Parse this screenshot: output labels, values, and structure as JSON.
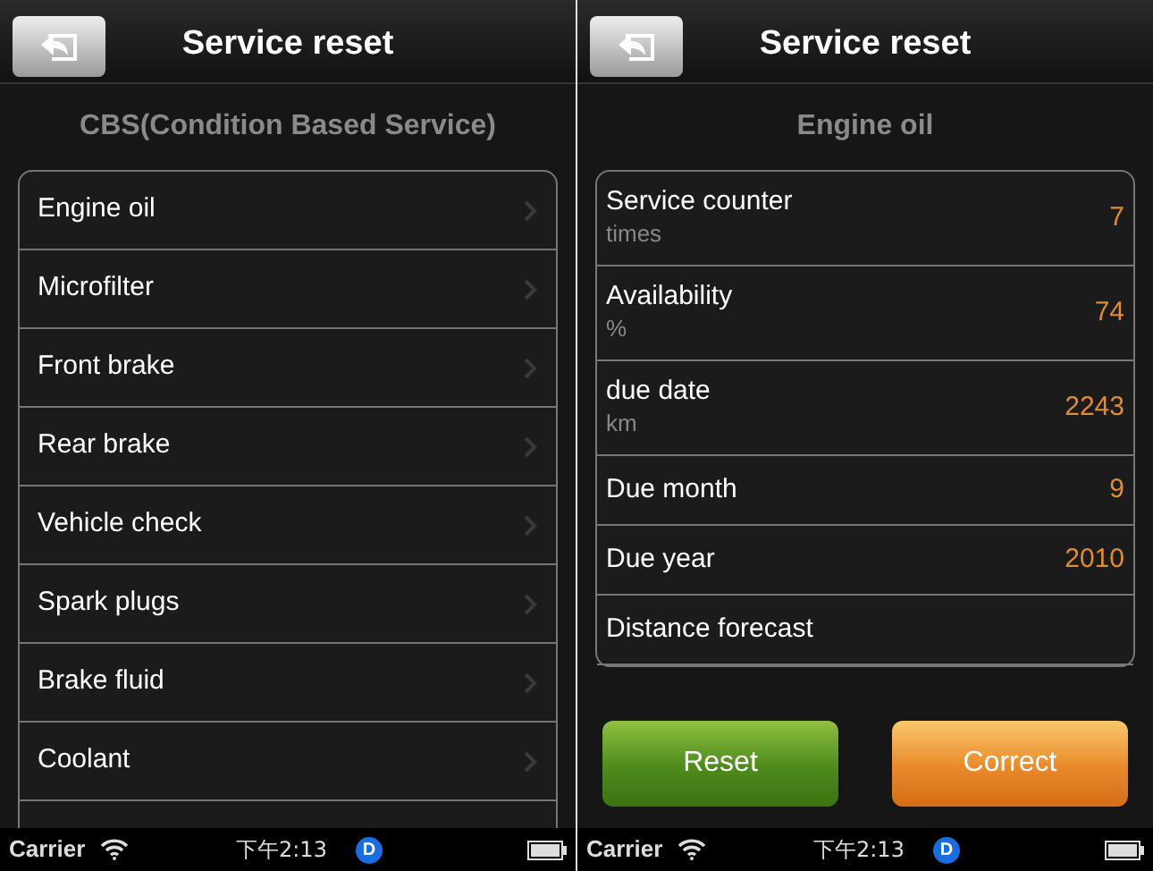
{
  "screens": [
    {
      "kind": "menu",
      "title": "Service reset",
      "subtitle": "CBS(Condition Based Service)",
      "items": [
        "Engine oil",
        "Microfilter",
        "Front brake",
        "Rear brake",
        "Vehicle check",
        "Spark plugs",
        "Brake fluid",
        "Coolant"
      ],
      "status_bar": {
        "carrier": "Carrier",
        "time": "下午2:13",
        "badge": "D"
      }
    },
    {
      "kind": "detail",
      "title": "Service reset",
      "subtitle": "Engine oil",
      "fields": [
        {
          "label": "Service counter",
          "unit": "times",
          "value": "7"
        },
        {
          "label": "Availability",
          "unit": "%",
          "value": "74"
        },
        {
          "label": "due date",
          "unit": "km",
          "value": "2243"
        },
        {
          "label": "Due month",
          "value": "9"
        },
        {
          "label": "Due year",
          "value": "2010"
        },
        {
          "label": "Distance forecast"
        }
      ],
      "buttons": [
        {
          "label": "Reset",
          "kind": "confirm"
        },
        {
          "label": "Correct",
          "kind": "warn"
        }
      ],
      "status_bar": {
        "carrier": "Carrier",
        "time": "下午2:13",
        "badge": "D"
      }
    }
  ]
}
